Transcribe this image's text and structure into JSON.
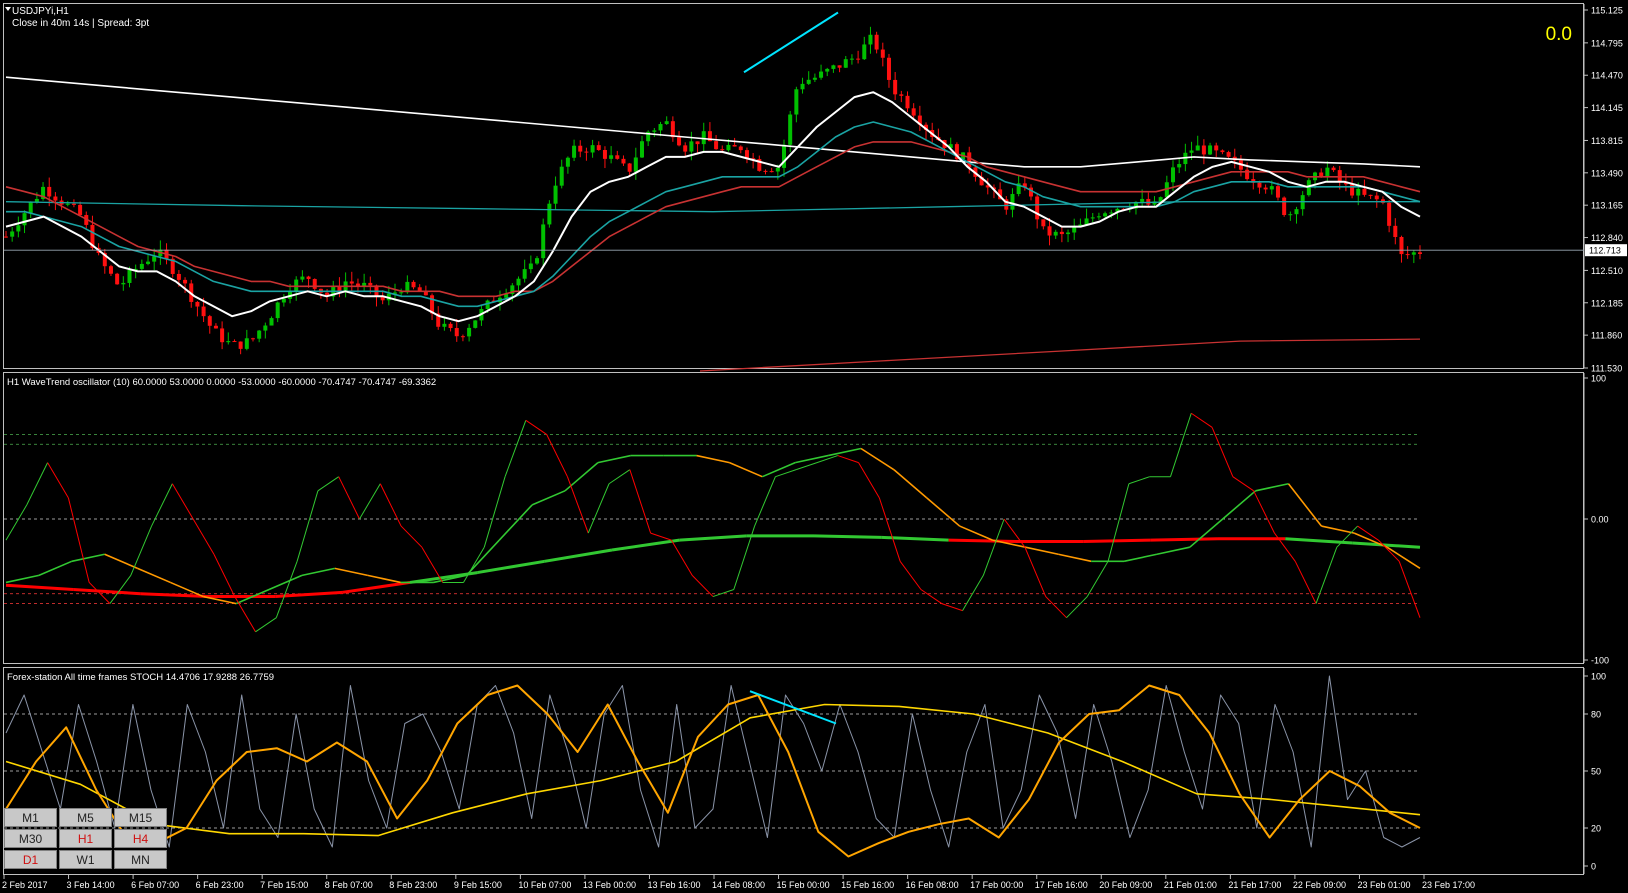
{
  "header": {
    "symbol_title": "USDJPYi,H1",
    "close_info": "Close in 40m 14s | Spread: 3pt",
    "corner_value": "0.0"
  },
  "colors": {
    "bull_candle": "#00c000",
    "bear_candle": "#ff1010",
    "price_ma_white": "#ffffff",
    "price_ma_teal": "#1aa3a3",
    "price_ma_red": "#c83232",
    "trend_line": "#00e5ff",
    "wt_green": "#32c832",
    "wt_red": "#ff0000",
    "wt_orange": "#ff9900",
    "stoch_gray": "#8a94a8",
    "stoch_orange": "#ffa500",
    "stoch_yellow": "#ffd700"
  },
  "chart_data": [
    {
      "type": "candlestick",
      "title": "USDJPYi,H1",
      "price_axis": [
        "115.125",
        "114.795",
        "114.470",
        "114.145",
        "113.815",
        "113.490",
        "113.165",
        "112.840",
        "112.510",
        "112.185",
        "111.860",
        "111.530"
      ],
      "ylim": [
        111.53,
        115.125
      ],
      "current_price": "112.713",
      "series": [
        {
          "name": "price",
          "values": [
            112.85,
            113.1,
            113.35,
            113.2,
            113.05,
            112.6,
            112.35,
            112.55,
            112.7,
            112.5,
            112.2,
            111.9,
            111.75,
            111.8,
            112.05,
            112.35,
            112.45,
            112.25,
            112.4,
            112.35,
            112.2,
            112.35,
            112.3,
            111.95,
            111.85,
            112.05,
            112.25,
            112.4,
            112.55,
            113.35,
            113.7,
            113.75,
            113.65,
            113.5,
            113.9,
            114.0,
            113.75,
            113.85,
            113.7,
            113.75,
            113.55,
            113.55,
            114.4,
            114.45,
            114.55,
            114.65,
            114.85,
            114.35,
            114.15,
            113.9,
            113.75,
            113.6,
            113.35,
            113.15,
            113.4,
            112.9,
            112.85,
            112.95,
            113.1,
            113.15,
            113.2,
            113.15,
            113.55,
            113.75,
            113.7,
            113.6,
            113.45,
            113.35,
            113.05,
            113.35,
            113.55,
            113.35,
            113.25,
            113.2,
            112.65,
            112.7
          ]
        },
        {
          "name": "ma-white",
          "values": [
            112.95,
            113.0,
            113.05,
            112.95,
            112.85,
            112.7,
            112.55,
            112.5,
            112.5,
            112.4,
            112.25,
            112.15,
            112.05,
            112.1,
            112.2,
            112.25,
            112.3,
            112.25,
            112.3,
            112.25,
            112.25,
            112.2,
            112.15,
            112.05,
            112.0,
            112.05,
            112.15,
            112.25,
            112.4,
            112.7,
            113.05,
            113.3,
            113.4,
            113.45,
            113.55,
            113.65,
            113.65,
            113.7,
            113.7,
            113.65,
            113.6,
            113.55,
            113.75,
            113.95,
            114.1,
            114.25,
            114.3,
            114.2,
            114.05,
            113.9,
            113.75,
            113.55,
            113.4,
            113.2,
            113.15,
            113.05,
            112.95,
            112.95,
            113.0,
            113.1,
            113.15,
            113.15,
            113.3,
            113.45,
            113.55,
            113.6,
            113.55,
            113.5,
            113.4,
            113.35,
            113.4,
            113.4,
            113.35,
            113.3,
            113.15,
            113.05
          ]
        },
        {
          "name": "ma-teal",
          "values": [
            113.1,
            113.1,
            113.05,
            113.0,
            112.95,
            112.85,
            112.75,
            112.7,
            112.65,
            112.6,
            112.5,
            112.4,
            112.35,
            112.3,
            112.3,
            112.3,
            112.3,
            112.3,
            112.3,
            112.3,
            112.3,
            112.25,
            112.25,
            112.2,
            112.15,
            112.15,
            112.2,
            112.25,
            112.3,
            112.45,
            112.65,
            112.85,
            113.0,
            113.1,
            113.2,
            113.3,
            113.35,
            113.4,
            113.45,
            113.45,
            113.45,
            113.45,
            113.55,
            113.7,
            113.85,
            113.95,
            114.0,
            113.95,
            113.9,
            113.8,
            113.7,
            113.6,
            113.5,
            113.4,
            113.35,
            113.25,
            113.2,
            113.15,
            113.15,
            113.15,
            113.15,
            113.15,
            113.2,
            113.3,
            113.35,
            113.4,
            113.4,
            113.4,
            113.35,
            113.35,
            113.35,
            113.35,
            113.35,
            113.3,
            113.25,
            113.2
          ]
        },
        {
          "name": "ma-red",
          "values": [
            113.35,
            113.3,
            113.25,
            113.15,
            113.05,
            112.95,
            112.85,
            112.75,
            112.7,
            112.65,
            112.55,
            112.5,
            112.45,
            112.4,
            112.4,
            112.35,
            112.35,
            112.35,
            112.35,
            112.35,
            112.35,
            112.3,
            112.3,
            112.3,
            112.25,
            112.25,
            112.25,
            112.3,
            112.3,
            112.4,
            112.55,
            112.7,
            112.85,
            112.95,
            113.05,
            113.15,
            113.2,
            113.25,
            113.3,
            113.35,
            113.35,
            113.35,
            113.45,
            113.55,
            113.65,
            113.75,
            113.8,
            113.8,
            113.8,
            113.75,
            113.7,
            113.65,
            113.55,
            113.5,
            113.45,
            113.4,
            113.35,
            113.3,
            113.3,
            113.3,
            113.3,
            113.3,
            113.35,
            113.4,
            113.45,
            113.5,
            113.5,
            113.5,
            113.5,
            113.45,
            113.45,
            113.45,
            113.45,
            113.4,
            113.35,
            113.3
          ]
        },
        {
          "name": "ma-slow-white",
          "values": [
            114.45,
            114.4,
            114.35,
            114.3,
            114.25,
            114.2,
            114.15,
            114.1,
            114.05,
            114.0,
            113.95,
            113.9,
            113.85,
            113.8,
            113.75,
            113.7,
            113.65,
            113.6,
            113.55,
            113.55,
            113.6,
            113.65,
            113.62,
            113.6,
            113.58,
            113.55
          ]
        },
        {
          "name": "ma-slow-teal",
          "values": [
            113.2,
            113.16,
            113.13,
            113.1,
            113.15,
            113.2,
            113.2
          ]
        },
        {
          "name": "ma-slow-red",
          "values": [
            111.5,
            111.6,
            111.7,
            111.8,
            111.82
          ]
        }
      ]
    },
    {
      "type": "line",
      "title": "H1 WaveTrend oscillator (10) 60.0000 53.0000 0.0000 -53.0000 -60.0000 -70.4747 -70.4747 -69.3362",
      "axis_labels": [
        "100",
        "0.00",
        "-100"
      ],
      "ylim": [
        -100,
        100
      ],
      "levels": [
        60,
        53,
        0,
        -53,
        -60
      ],
      "series": [
        {
          "name": "fast",
          "values": [
            -15,
            10,
            40,
            15,
            -45,
            -60,
            -40,
            -5,
            25,
            0,
            -25,
            -55,
            -80,
            -70,
            -30,
            20,
            30,
            0,
            25,
            -5,
            -20,
            -45,
            -45,
            -20,
            30,
            70,
            60,
            30,
            -10,
            25,
            35,
            -10,
            -15,
            -40,
            -55,
            -50,
            -5,
            30,
            35,
            40,
            45,
            40,
            15,
            -30,
            -50,
            -60,
            -65,
            -40,
            0,
            -20,
            -55,
            -70,
            -55,
            -30,
            25,
            30,
            30,
            75,
            65,
            30,
            20,
            -10,
            -30,
            -60,
            -20,
            -5,
            -15,
            -30,
            -70
          ]
        },
        {
          "name": "signal",
          "values": [
            -45,
            -40,
            -30,
            -25,
            -35,
            -45,
            -55,
            -60,
            -50,
            -40,
            -35,
            -40,
            -45,
            -45,
            -40,
            -15,
            10,
            20,
            40,
            45,
            45,
            45,
            40,
            30,
            40,
            45,
            50,
            35,
            15,
            -5,
            -15,
            -20,
            -25,
            -30,
            -30,
            -25,
            -20,
            0,
            20,
            25,
            -5,
            -10,
            -20,
            -35
          ]
        },
        {
          "name": "trend",
          "values": [
            -47,
            -50,
            -53,
            -55,
            -55,
            -52,
            -45,
            -38,
            -30,
            -22,
            -15,
            -12,
            -12,
            -13,
            -15,
            -16,
            -16,
            -15,
            -14,
            -14,
            -17,
            -20
          ]
        }
      ]
    },
    {
      "type": "line",
      "title": "Forex-station All time frames STOCH 14.4706 17.9288 26.7759",
      "axis_labels": [
        "100",
        "80",
        "50",
        "20",
        "0"
      ],
      "ylim": [
        0,
        100
      ],
      "levels": [
        80,
        50,
        20
      ],
      "series": [
        {
          "name": "stoch-fast",
          "values": [
            70,
            90,
            60,
            30,
            85,
            55,
            20,
            85,
            40,
            10,
            85,
            60,
            20,
            90,
            30,
            15,
            80,
            30,
            10,
            95,
            45,
            20,
            75,
            80,
            60,
            30,
            85,
            95,
            70,
            25,
            90,
            60,
            20,
            80,
            95,
            40,
            10,
            85,
            20,
            30,
            95,
            55,
            15,
            90,
            75,
            50,
            85,
            60,
            25,
            15,
            80,
            40,
            10,
            60,
            85,
            20,
            40,
            90,
            70,
            25,
            85,
            55,
            15,
            40,
            95,
            60,
            30,
            90,
            75,
            20,
            85,
            60,
            10,
            100,
            35,
            50,
            15,
            10,
            15
          ]
        },
        {
          "name": "stoch-slow",
          "values": [
            30,
            55,
            73,
            40,
            15,
            12,
            20,
            45,
            60,
            62,
            55,
            65,
            55,
            25,
            45,
            75,
            90,
            95,
            80,
            60,
            85,
            55,
            28,
            68,
            85,
            90,
            60,
            18,
            5,
            12,
            18,
            22,
            25,
            15,
            35,
            65,
            80,
            82,
            95,
            90,
            70,
            38,
            15,
            35,
            50,
            42,
            28,
            20
          ]
        },
        {
          "name": "stoch-higher-tf",
          "values": [
            55,
            43,
            22,
            17,
            17,
            16,
            28,
            38,
            45,
            55,
            78,
            85,
            84,
            80,
            70,
            55,
            38,
            35,
            31,
            27
          ]
        }
      ]
    }
  ],
  "time_axis": [
    "2 Feb 2017",
    "3 Feb 14:00",
    "6 Feb 07:00",
    "6 Feb 23:00",
    "7 Feb 15:00",
    "8 Feb 07:00",
    "8 Feb 23:00",
    "9 Feb 15:00",
    "10 Feb 07:00",
    "13 Feb 00:00",
    "13 Feb 16:00",
    "14 Feb 08:00",
    "15 Feb 00:00",
    "15 Feb 16:00",
    "16 Feb 08:00",
    "17 Feb 00:00",
    "17 Feb 16:00",
    "20 Feb 09:00",
    "21 Feb 01:00",
    "21 Feb 17:00",
    "22 Feb 09:00",
    "23 Feb 01:00",
    "23 Feb 17:00"
  ],
  "timeframes": {
    "buttons": [
      {
        "label": "M1",
        "active": false
      },
      {
        "label": "M5",
        "active": false
      },
      {
        "label": "M15",
        "active": false
      },
      {
        "label": "M30",
        "active": false
      },
      {
        "label": "H1",
        "active": true
      },
      {
        "label": "H4",
        "active": true
      },
      {
        "label": "D1",
        "active": true
      },
      {
        "label": "W1",
        "active": false
      },
      {
        "label": "MN",
        "active": false
      }
    ]
  }
}
